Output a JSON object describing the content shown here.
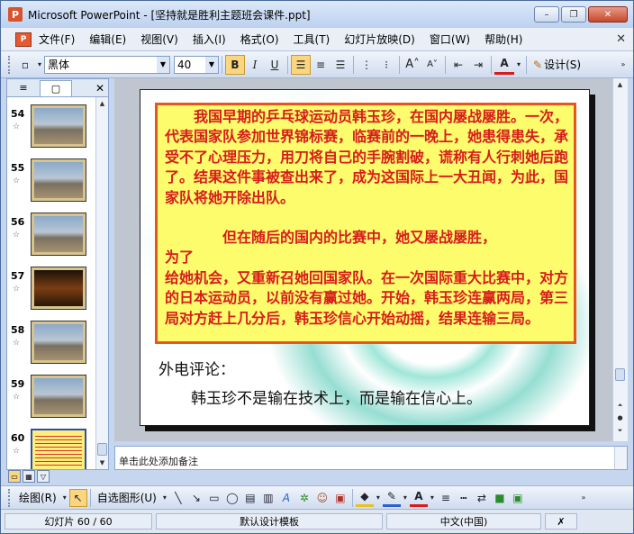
{
  "window": {
    "title": "Microsoft PowerPoint - [坚持就是胜利主题班会课件.ppt]",
    "minimize_glyph": "–",
    "restore_glyph": "❐",
    "close_glyph": "✕"
  },
  "menu": {
    "items": [
      "文件(F)",
      "编辑(E)",
      "视图(V)",
      "插入(I)",
      "格式(O)",
      "工具(T)",
      "幻灯片放映(D)",
      "窗口(W)",
      "帮助(H)"
    ],
    "close_glyph": "✕"
  },
  "toolbar": {
    "font_name": "黑体",
    "font_size": "40",
    "bold": "B",
    "italic": "I",
    "underline": "U",
    "font_color_label": "A",
    "design_label": "设计(S)"
  },
  "left_pane": {
    "tab_outline_icon": "≡",
    "tab_slides_icon": "▢",
    "close_glyph": "✕",
    "slides": [
      {
        "number": "54",
        "selected": false
      },
      {
        "number": "55",
        "selected": false
      },
      {
        "number": "56",
        "selected": false
      },
      {
        "number": "57",
        "selected": false
      },
      {
        "number": "58",
        "selected": false
      },
      {
        "number": "59",
        "selected": false
      },
      {
        "number": "60",
        "selected": true
      }
    ],
    "star_glyph": "☆"
  },
  "slide": {
    "paragraph1": "　　我国早期的乒乓球运动员韩玉珍，在国内屡战屡胜。一次，代表国家队参加世界锦标赛，临赛前的一晚上，她患得患失，承受不了心理压力，用刀将自己的手腕割破，谎称有人行刺她后跑了。结果这件事被查出来了，成为这国际上一大丑闻，为此，国家队将她开除出队。",
    "paragraph2_line1": "　　　　但在随后的国内的比赛中，她又屡战屡胜，",
    "paragraph2_line2": "为了",
    "paragraph3": "给她机会，又重新召她回国家队。在一次国际重大比赛中，对方的日本运动员，以前没有赢过她。开始，韩玉珍连赢两局，第三局对方赶上几分后，韩玉珍信心开始动摇，结果连输三局。",
    "comment_label": "外电评论：",
    "comment_text": "韩玉珍不是输在技术上，而是输在信心上。"
  },
  "notes": {
    "placeholder": "单击此处添加备注"
  },
  "drawbar": {
    "draw_label": "绘图(R)",
    "autoshapes_label": "自选图形(U)"
  },
  "status": {
    "slide_info": "幻灯片 60 / 60",
    "template": "默认设计模板",
    "language": "中文(中国)"
  }
}
